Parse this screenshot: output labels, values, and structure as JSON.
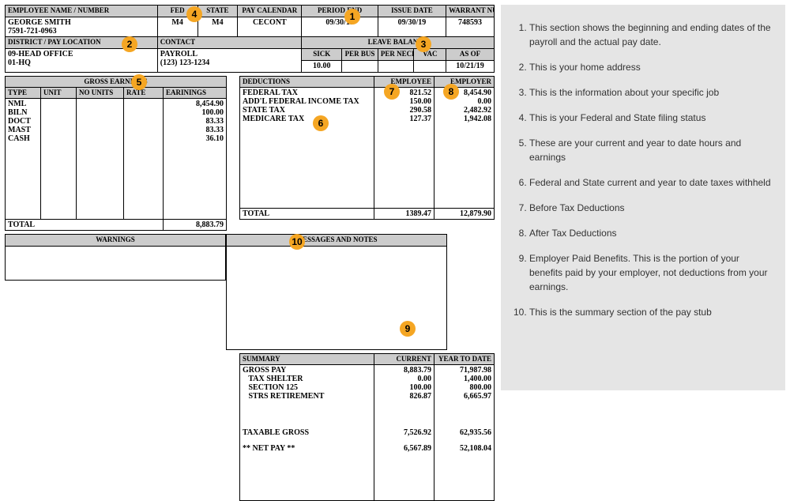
{
  "header": {
    "labels": {
      "name": "EMPLOYEE NAME / NUMBER",
      "fed": "FED",
      "state": "STATE",
      "paycal": "PAY CALENDAR",
      "period": "PERIOD END",
      "issue": "ISSUE DATE",
      "warrant": "WARRANT NUMBER",
      "district": "DISTRICT / PAY LOCATION",
      "contact": "CONTACT",
      "leave": "LEAVE BALANCE",
      "sick": "SICK",
      "perbus": "PER BUS",
      "perneces": "PER NECES",
      "vac": "VAC",
      "asof": "AS OF"
    },
    "name": "GEORGE SMITH",
    "empno": "7591-721-0963",
    "fed": "M4",
    "state": "M4",
    "paycal": "CECONT",
    "period": "09/30/19",
    "issue": "09/30/19",
    "warrant": "748593",
    "district1": "09-HEAD OFFICE",
    "district2": "01-HQ",
    "contact1": "PAYROLL",
    "contact2": "(123) 123-1234",
    "sick": "10.00",
    "asof": "10/21/19"
  },
  "earnings": {
    "title": "GROSS EARNINGS",
    "cols": {
      "type": "TYPE",
      "unit": "UNIT",
      "nounits": "NO UNITS",
      "rate": "RATE",
      "earn": "EARININGS"
    },
    "rows": [
      {
        "type": "NML",
        "earn": "8,454.90"
      },
      {
        "type": "BILN",
        "earn": "100.00"
      },
      {
        "type": "DOCT",
        "earn": "83.33"
      },
      {
        "type": "MAST",
        "earn": "83.33"
      },
      {
        "type": "CASH",
        "earn": "36.10"
      }
    ],
    "total_label": "TOTAL",
    "total": "8,883.79"
  },
  "deductions": {
    "title": "DEDUCTIONS",
    "emp": "EMPLOYEE",
    "empr": "EMPLOYER",
    "rows": [
      {
        "name": "FEDERAL TAX",
        "emp": "821.52",
        "empr": "8,454.90"
      },
      {
        "name": "ADD'L FEDERAL INCOME TAX",
        "emp": "150.00",
        "empr": "0.00"
      },
      {
        "name": "STATE TAX",
        "emp": "290.58",
        "empr": "2,482.92"
      },
      {
        "name": "MEDICARE TAX",
        "emp": "127.37",
        "empr": "1,942.08"
      }
    ],
    "total_label": "TOTAL",
    "total_emp": "1389.47",
    "total_empr": "12,879.90"
  },
  "warnings": {
    "title": "WARNINGS"
  },
  "messages": {
    "title": "MESSAGES AND NOTES"
  },
  "summary": {
    "title": "SUMMARY",
    "cur": "CURRENT",
    "ytd": "YEAR TO DATE",
    "rows": [
      {
        "name": "GROSS PAY",
        "cur": "8,883.79",
        "ytd": "71,987.98"
      },
      {
        "name": "   TAX SHELTER",
        "cur": "0.00",
        "ytd": "1,400.00"
      },
      {
        "name": "   SECTION 125",
        "cur": "100.00",
        "ytd": "800.00"
      },
      {
        "name": "   STRS RETIREMENT",
        "cur": "826.87",
        "ytd": "6,665.97"
      }
    ],
    "taxable": {
      "name": "TAXABLE GROSS",
      "cur": "7,526.92",
      "ytd": "62,935.56"
    },
    "net": {
      "name": "** NET PAY **",
      "cur": "6,567.89",
      "ytd": "52,108.04"
    }
  },
  "legend": [
    "This section shows the beginning and ending dates of the payroll and the actual pay date.",
    "This is your home address",
    "This is the information about your specific job",
    "This is your Federal and State filing status",
    "These are your current and year to date hours and earnings",
    "Federal and State current and year to date taxes withheld",
    "Before Tax Deductions",
    "After Tax Deductions",
    "Employer Paid Benefits. This is the portion of your benefits paid by your employer, not deductions from your earnings.",
    "This is the summary section of the pay stub"
  ]
}
